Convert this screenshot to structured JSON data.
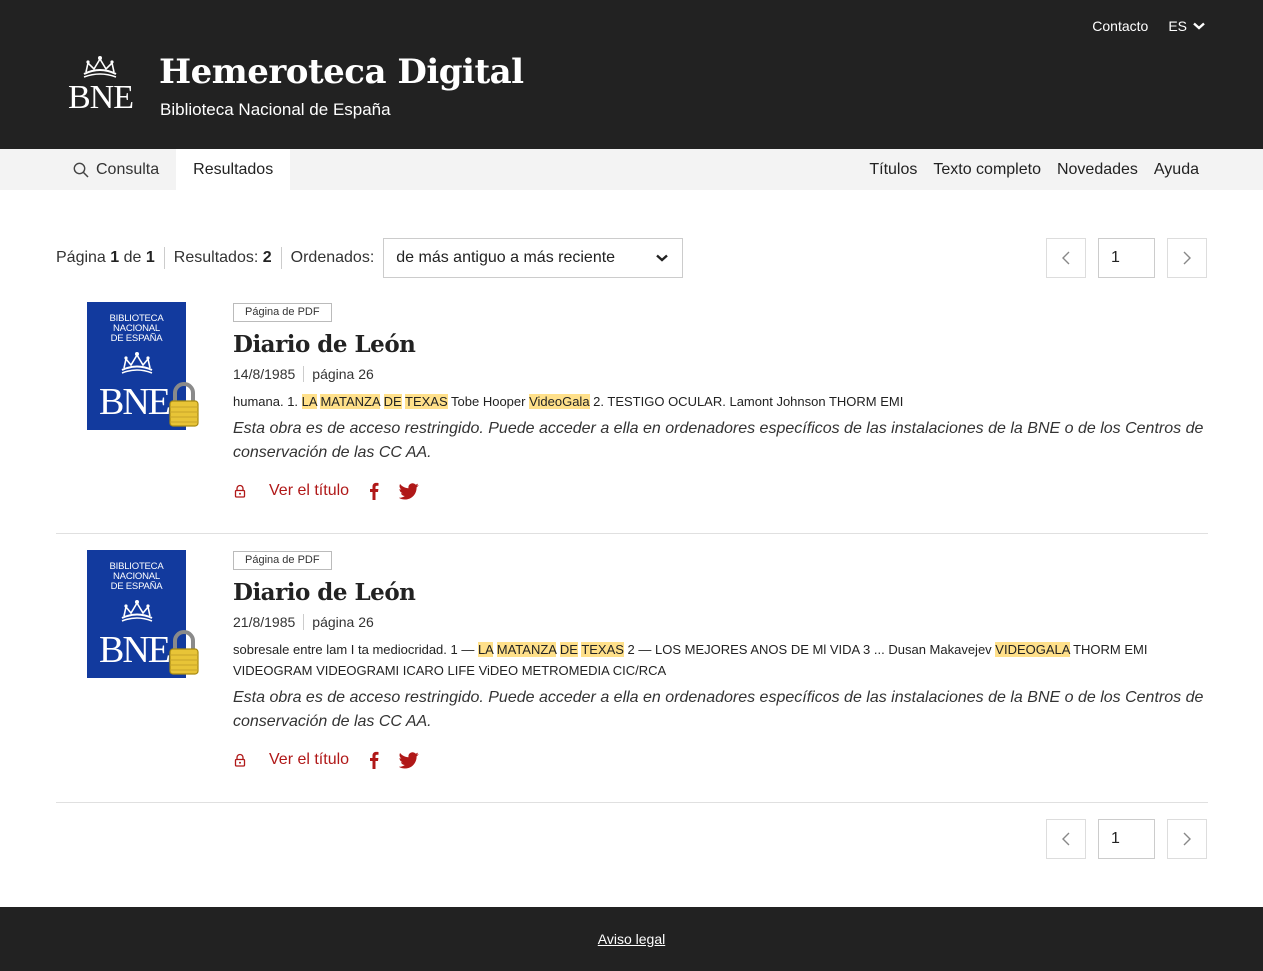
{
  "header": {
    "contact": "Contacto",
    "language": "ES",
    "logo_text": "BNE",
    "title": "Hemeroteca Digital",
    "subtitle": "Biblioteca Nacional de España"
  },
  "nav": {
    "tabs": [
      {
        "label": "Consulta",
        "icon": "search-icon",
        "active": false
      },
      {
        "label": "Resultados",
        "active": true
      }
    ],
    "links": [
      "Títulos",
      "Texto completo",
      "Novedades",
      "Ayuda"
    ]
  },
  "toolbar": {
    "page_label": "Página",
    "page_current": "1",
    "page_of": "de",
    "page_total": "1",
    "results_label": "Resultados:",
    "results_count": "2",
    "sort_label": "Ordenados:",
    "sort_value": "de más antiguo a más reciente"
  },
  "pager": {
    "page_value": "1"
  },
  "thumb": {
    "line1": "BIBLIOTECA",
    "line2": "NACIONAL",
    "line3": "DE ESPAÑA",
    "logo": "BNE"
  },
  "results": [
    {
      "badge": "Página de PDF",
      "title": "Diario de León",
      "date": "14/8/1985",
      "page": "página 26",
      "snippet": [
        {
          "t": "humana. 1. ",
          "h": false
        },
        {
          "t": "LA",
          "h": true
        },
        {
          "t": " ",
          "h": false
        },
        {
          "t": "MATANZA",
          "h": true
        },
        {
          "t": " ",
          "h": false
        },
        {
          "t": "DE",
          "h": true
        },
        {
          "t": " ",
          "h": false
        },
        {
          "t": "TEXAS",
          "h": true
        },
        {
          "t": " Tobe Hooper ",
          "h": false
        },
        {
          "t": "VideoGala",
          "h": true
        },
        {
          "t": " 2. TESTIGO OCULAR. Lamont Johnson THORM EMI",
          "h": false
        }
      ],
      "restricted": "Esta obra es de acceso restringido. Puede acceder a ella en ordenadores específicos de las instalaciones de la BNE o de los Centros de conservación de las CC AA.",
      "view_label": "Ver el título"
    },
    {
      "badge": "Página de PDF",
      "title": "Diario de León",
      "date": "21/8/1985",
      "page": "página 26",
      "snippet": [
        {
          "t": "sobresale entre lam I ta mediocridad. 1 — ",
          "h": false
        },
        {
          "t": "LA",
          "h": true
        },
        {
          "t": " ",
          "h": false
        },
        {
          "t": "MATANZA",
          "h": true
        },
        {
          "t": " ",
          "h": false
        },
        {
          "t": "DE",
          "h": true
        },
        {
          "t": " ",
          "h": false
        },
        {
          "t": "TEXAS",
          "h": true
        },
        {
          "t": " 2 — LOS MEJORES ANOS DE Ml VIDA 3 ... Dusan Makavejev ",
          "h": false
        },
        {
          "t": "VIDEOGALA",
          "h": true
        },
        {
          "t": " THORM EMI VIDEOGRAM VIDEOGRAMI ICARO LIFE ViDEO METROMEDIA CIC/RCA",
          "h": false
        }
      ],
      "restricted": "Esta obra es de acceso restringido. Puede acceder a ella en ordenadores específicos de las instalaciones de la BNE o de los Centros de conservación de las CC AA.",
      "view_label": "Ver el título"
    }
  ],
  "footer": {
    "legal": "Aviso legal"
  },
  "colors": {
    "header_bg": "#222222",
    "accent_red": "#b01818",
    "highlight": "#ffe08a",
    "thumb_blue": "#123a9e"
  }
}
